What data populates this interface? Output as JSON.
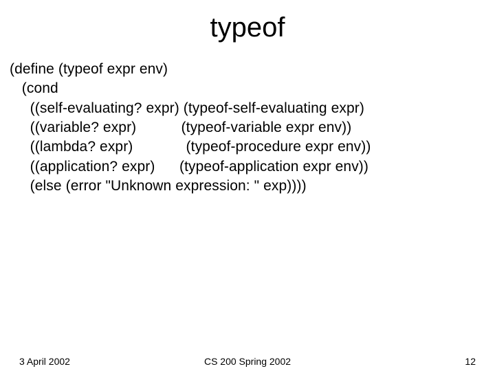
{
  "title": "typeof",
  "code": {
    "l1": "(define (typeof expr env)",
    "l2": "   (cond",
    "l3": "     ((self-evaluating? expr) (typeof-self-evaluating expr)",
    "l4": "     ((variable? expr)           (typeof-variable expr env))",
    "l5": "     ((lambda? expr)             (typeof-procedure expr env))",
    "l6": "     ((application? expr)      (typeof-application expr env))",
    "l7": "     (else (error \"Unknown expression: \" exp))))"
  },
  "footer": {
    "date": "3 April 2002",
    "course": "CS 200 Spring 2002",
    "page": "12"
  }
}
